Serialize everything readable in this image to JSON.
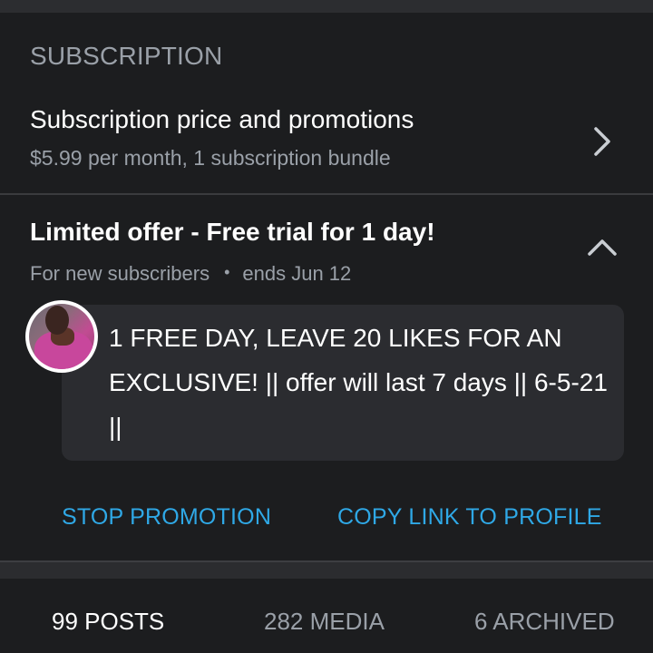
{
  "section": {
    "title": "SUBSCRIPTION"
  },
  "subscription_row": {
    "title": "Subscription price and promotions",
    "subtitle": "$5.99 per month, 1 subscription bundle"
  },
  "offer": {
    "title": "Limited offer - Free trial for 1 day!",
    "audience": "For new subscribers",
    "separator": "•",
    "ends": "ends Jun 12",
    "message": "1 FREE DAY, LEAVE 20 LIKES FOR AN EXCLUSIVE! || offer will last 7 days || 6-5-21 ||"
  },
  "actions": {
    "stop_label": "STOP PROMOTION",
    "copy_label": "COPY LINK TO PROFILE"
  },
  "tabs": [
    {
      "label": "99 POSTS",
      "active": true
    },
    {
      "label": "282 MEDIA",
      "active": false
    },
    {
      "label": "6 ARCHIVED",
      "active": false
    }
  ],
  "colors": {
    "background": "#1c1d1f",
    "accent": "#2fa8e6",
    "muted_text": "#9aa0a8"
  },
  "icons": {
    "row_chevron": "chevron-right-icon",
    "collapse_chevron": "chevron-up-icon"
  }
}
